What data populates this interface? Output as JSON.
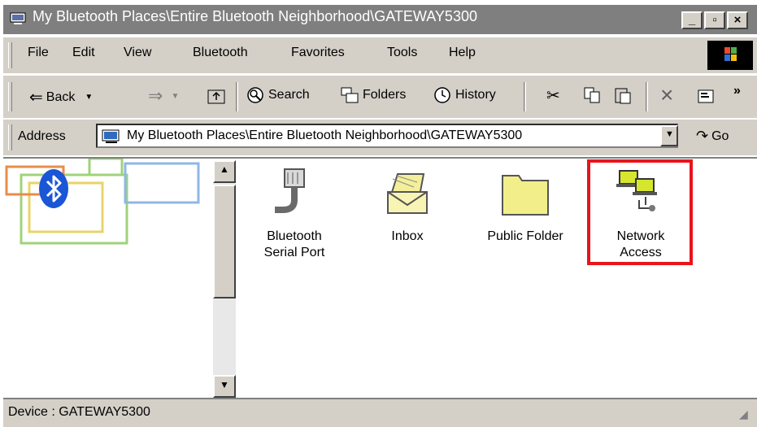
{
  "window": {
    "title": "My Bluetooth Places\\Entire Bluetooth Neighborhood\\GATEWAY5300"
  },
  "menu": [
    "File",
    "Edit",
    "View",
    "Bluetooth",
    "Favorites",
    "Tools",
    "Help"
  ],
  "toolbar": {
    "back": "Back",
    "search": "Search",
    "folders": "Folders",
    "history": "History",
    "overflow": "»"
  },
  "address": {
    "label": "Address",
    "value": "My Bluetooth Places\\Entire Bluetooth Neighborhood\\GATEWAY5300",
    "go": "Go"
  },
  "items": [
    {
      "label": "Bluetooth Serial Port",
      "icon": "serial-port-icon"
    },
    {
      "label": "Inbox",
      "icon": "inbox-icon"
    },
    {
      "label": "Public Folder",
      "icon": "folder-icon"
    },
    {
      "label": "Network Access",
      "icon": "network-access-icon",
      "highlighted": true
    }
  ],
  "status": {
    "text": "Device : GATEWAY5300"
  },
  "colors": {
    "titlebar": "#7f7f7f",
    "chrome": "#d4d0c8",
    "highlight_box": "#e8141c",
    "folder": "#f2ef8a"
  }
}
